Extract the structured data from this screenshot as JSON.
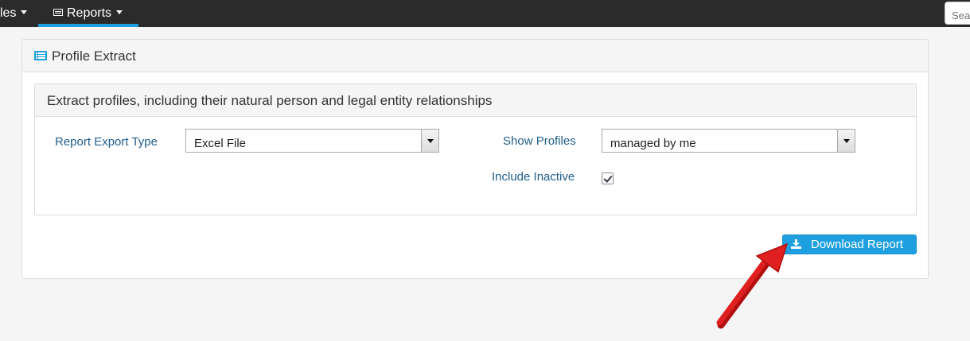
{
  "navbar": {
    "files_label": "les",
    "reports_label": "Reports",
    "search_placeholder": "Search"
  },
  "panel": {
    "title": "Profile Extract",
    "section_title": "Extract profiles, including their natural person and legal entity relationships",
    "report_export_type": {
      "label": "Report Export Type",
      "value": "Excel File"
    },
    "show_profiles": {
      "label": "Show Profiles",
      "value": "managed by me"
    },
    "include_inactive": {
      "label": "Include Inactive",
      "checked": true
    }
  },
  "download_button": {
    "label": "Download Report"
  },
  "colors": {
    "accent": "#1ea0e0",
    "navbar": "#2b2b2b",
    "annotation_arrow": "#e02020"
  }
}
